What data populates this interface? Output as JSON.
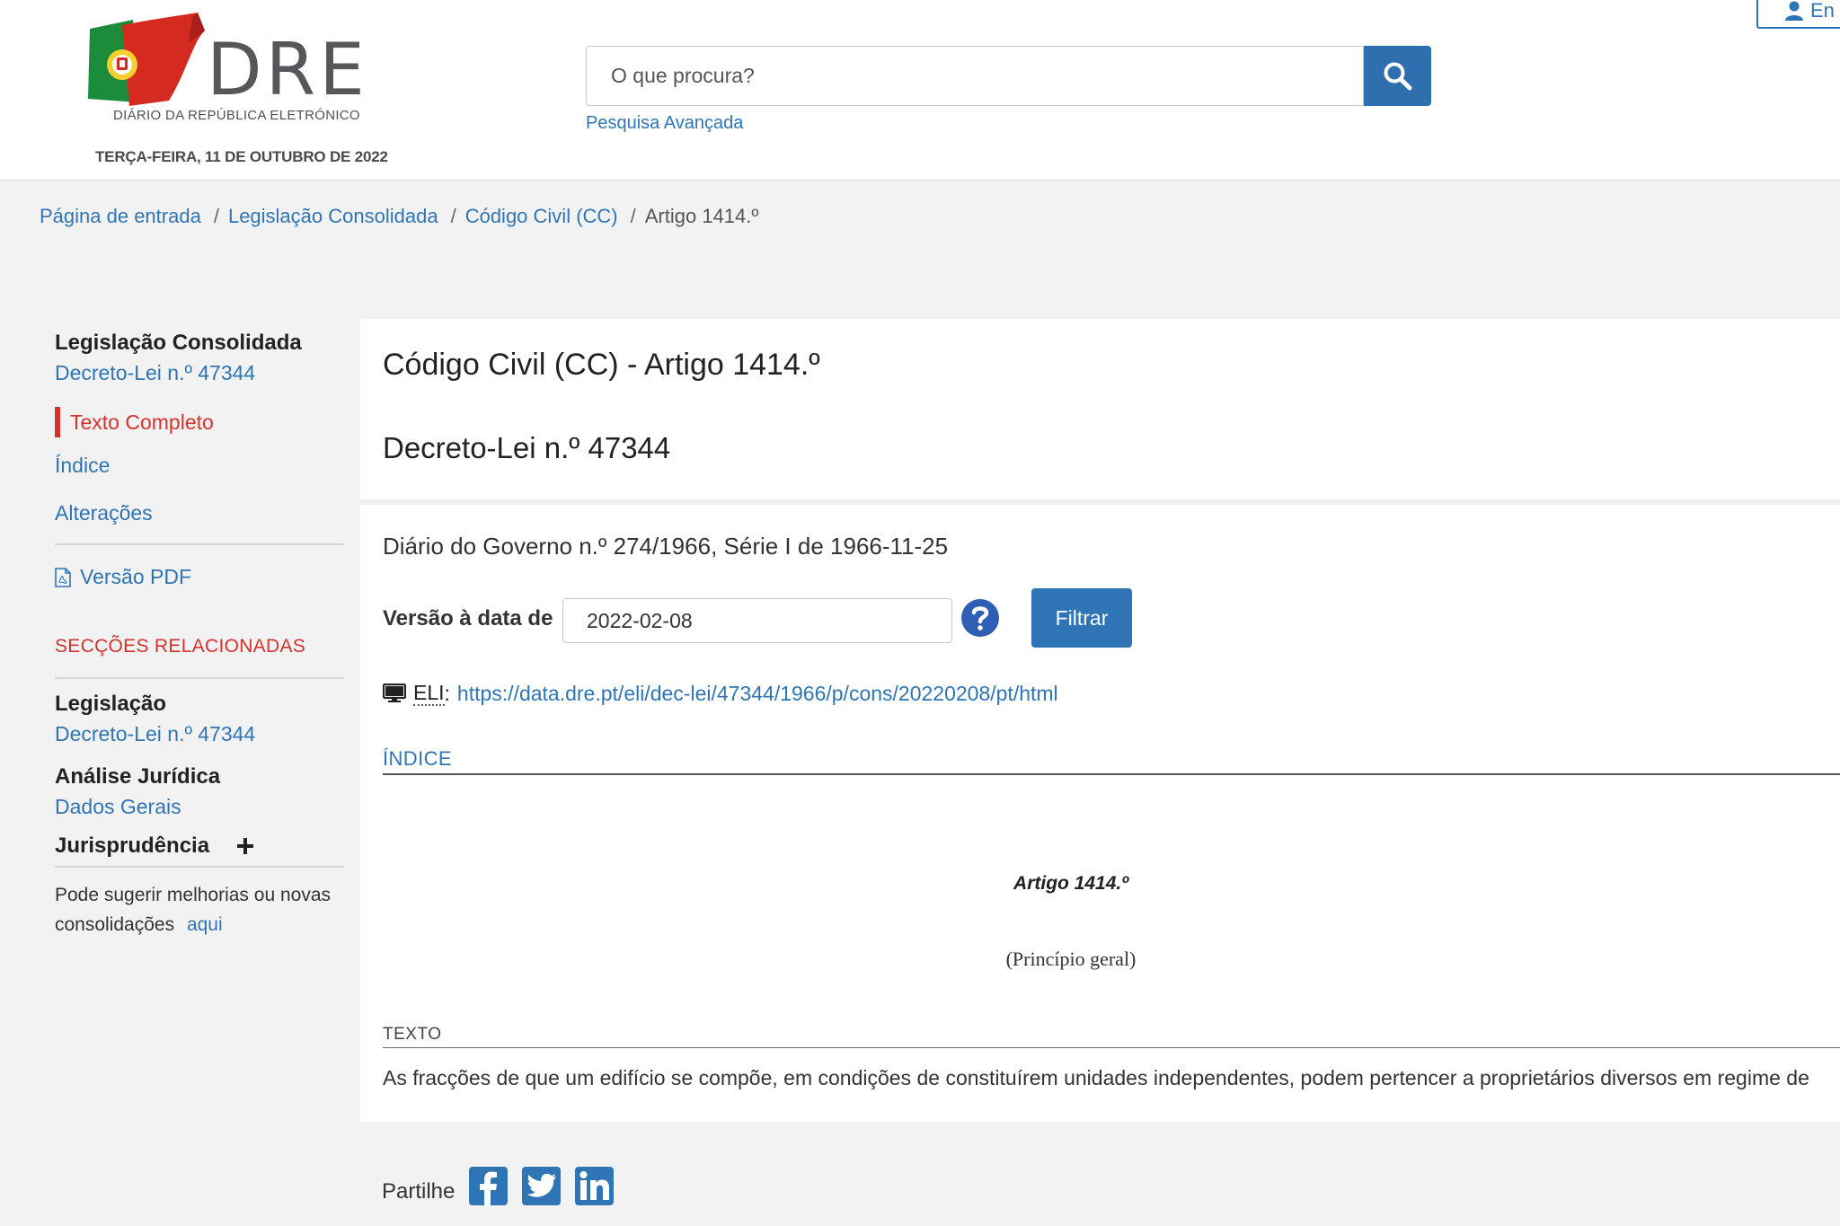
{
  "header": {
    "logo_letters": "DRE",
    "logo_subtitle": "DIÁRIO DA REPÚBLICA ELETRÓNICO",
    "date": "TERÇA-FEIRA, 11 DE OUTUBRO DE 2022",
    "search_placeholder": "O que procura?",
    "advanced_search": "Pesquisa Avançada",
    "login_label": "En"
  },
  "breadcrumb": {
    "items": [
      "Página de entrada",
      "Legislação Consolidada",
      "Código Civil (CC)"
    ],
    "separator": "/",
    "current": "Artigo 1414.º"
  },
  "sidebar": {
    "title": "Legislação Consolidada",
    "decree_link": "Decreto-Lei n.º 47344",
    "nav": [
      "Texto Completo",
      "Índice",
      "Alterações"
    ],
    "pdf_link": "Versão PDF",
    "related_heading": "SECÇÕES RELACIONADAS",
    "legislacao_title": "Legislação",
    "legislacao_link": "Decreto-Lei n.º 47344",
    "analise_title": "Análise Jurídica",
    "analise_link": "Dados Gerais",
    "jurisprudencia_title": "Jurisprudência",
    "suggest_text": "Pode sugerir melhorias ou novas consolidações",
    "suggest_link": "aqui"
  },
  "main": {
    "title": "Código Civil (CC) - Artigo 1414.º",
    "subtitle": "Decreto-Lei n.º 47344",
    "diario": "Diário do Governo n.º 274/1966, Série I de 1966-11-25",
    "versao_label": "Versão à data de",
    "versao_value": "2022-02-08",
    "filter_button": "Filtrar",
    "eli_label": "ELI",
    "eli_url": "https://data.dre.pt/eli/dec-lei/47344/1966/p/cons/20220208/pt/html",
    "indice_label": "ÍNDICE",
    "article_heading": "Artigo 1414.º",
    "article_subheading": "(Princípio geral)",
    "texto_label": "TEXTO",
    "texto_body": "As fracções de que um edifício se compõe, em condições de constituírem unidades independentes, podem pertencer a proprietários diversos em regime de"
  },
  "share": {
    "label": "Partilhe",
    "networks": [
      "facebook-icon",
      "twitter-icon",
      "linkedin-icon"
    ]
  },
  "colors": {
    "primary": "#2f75b5",
    "accent_red": "#d5322e",
    "background": "#f2f2f2"
  }
}
